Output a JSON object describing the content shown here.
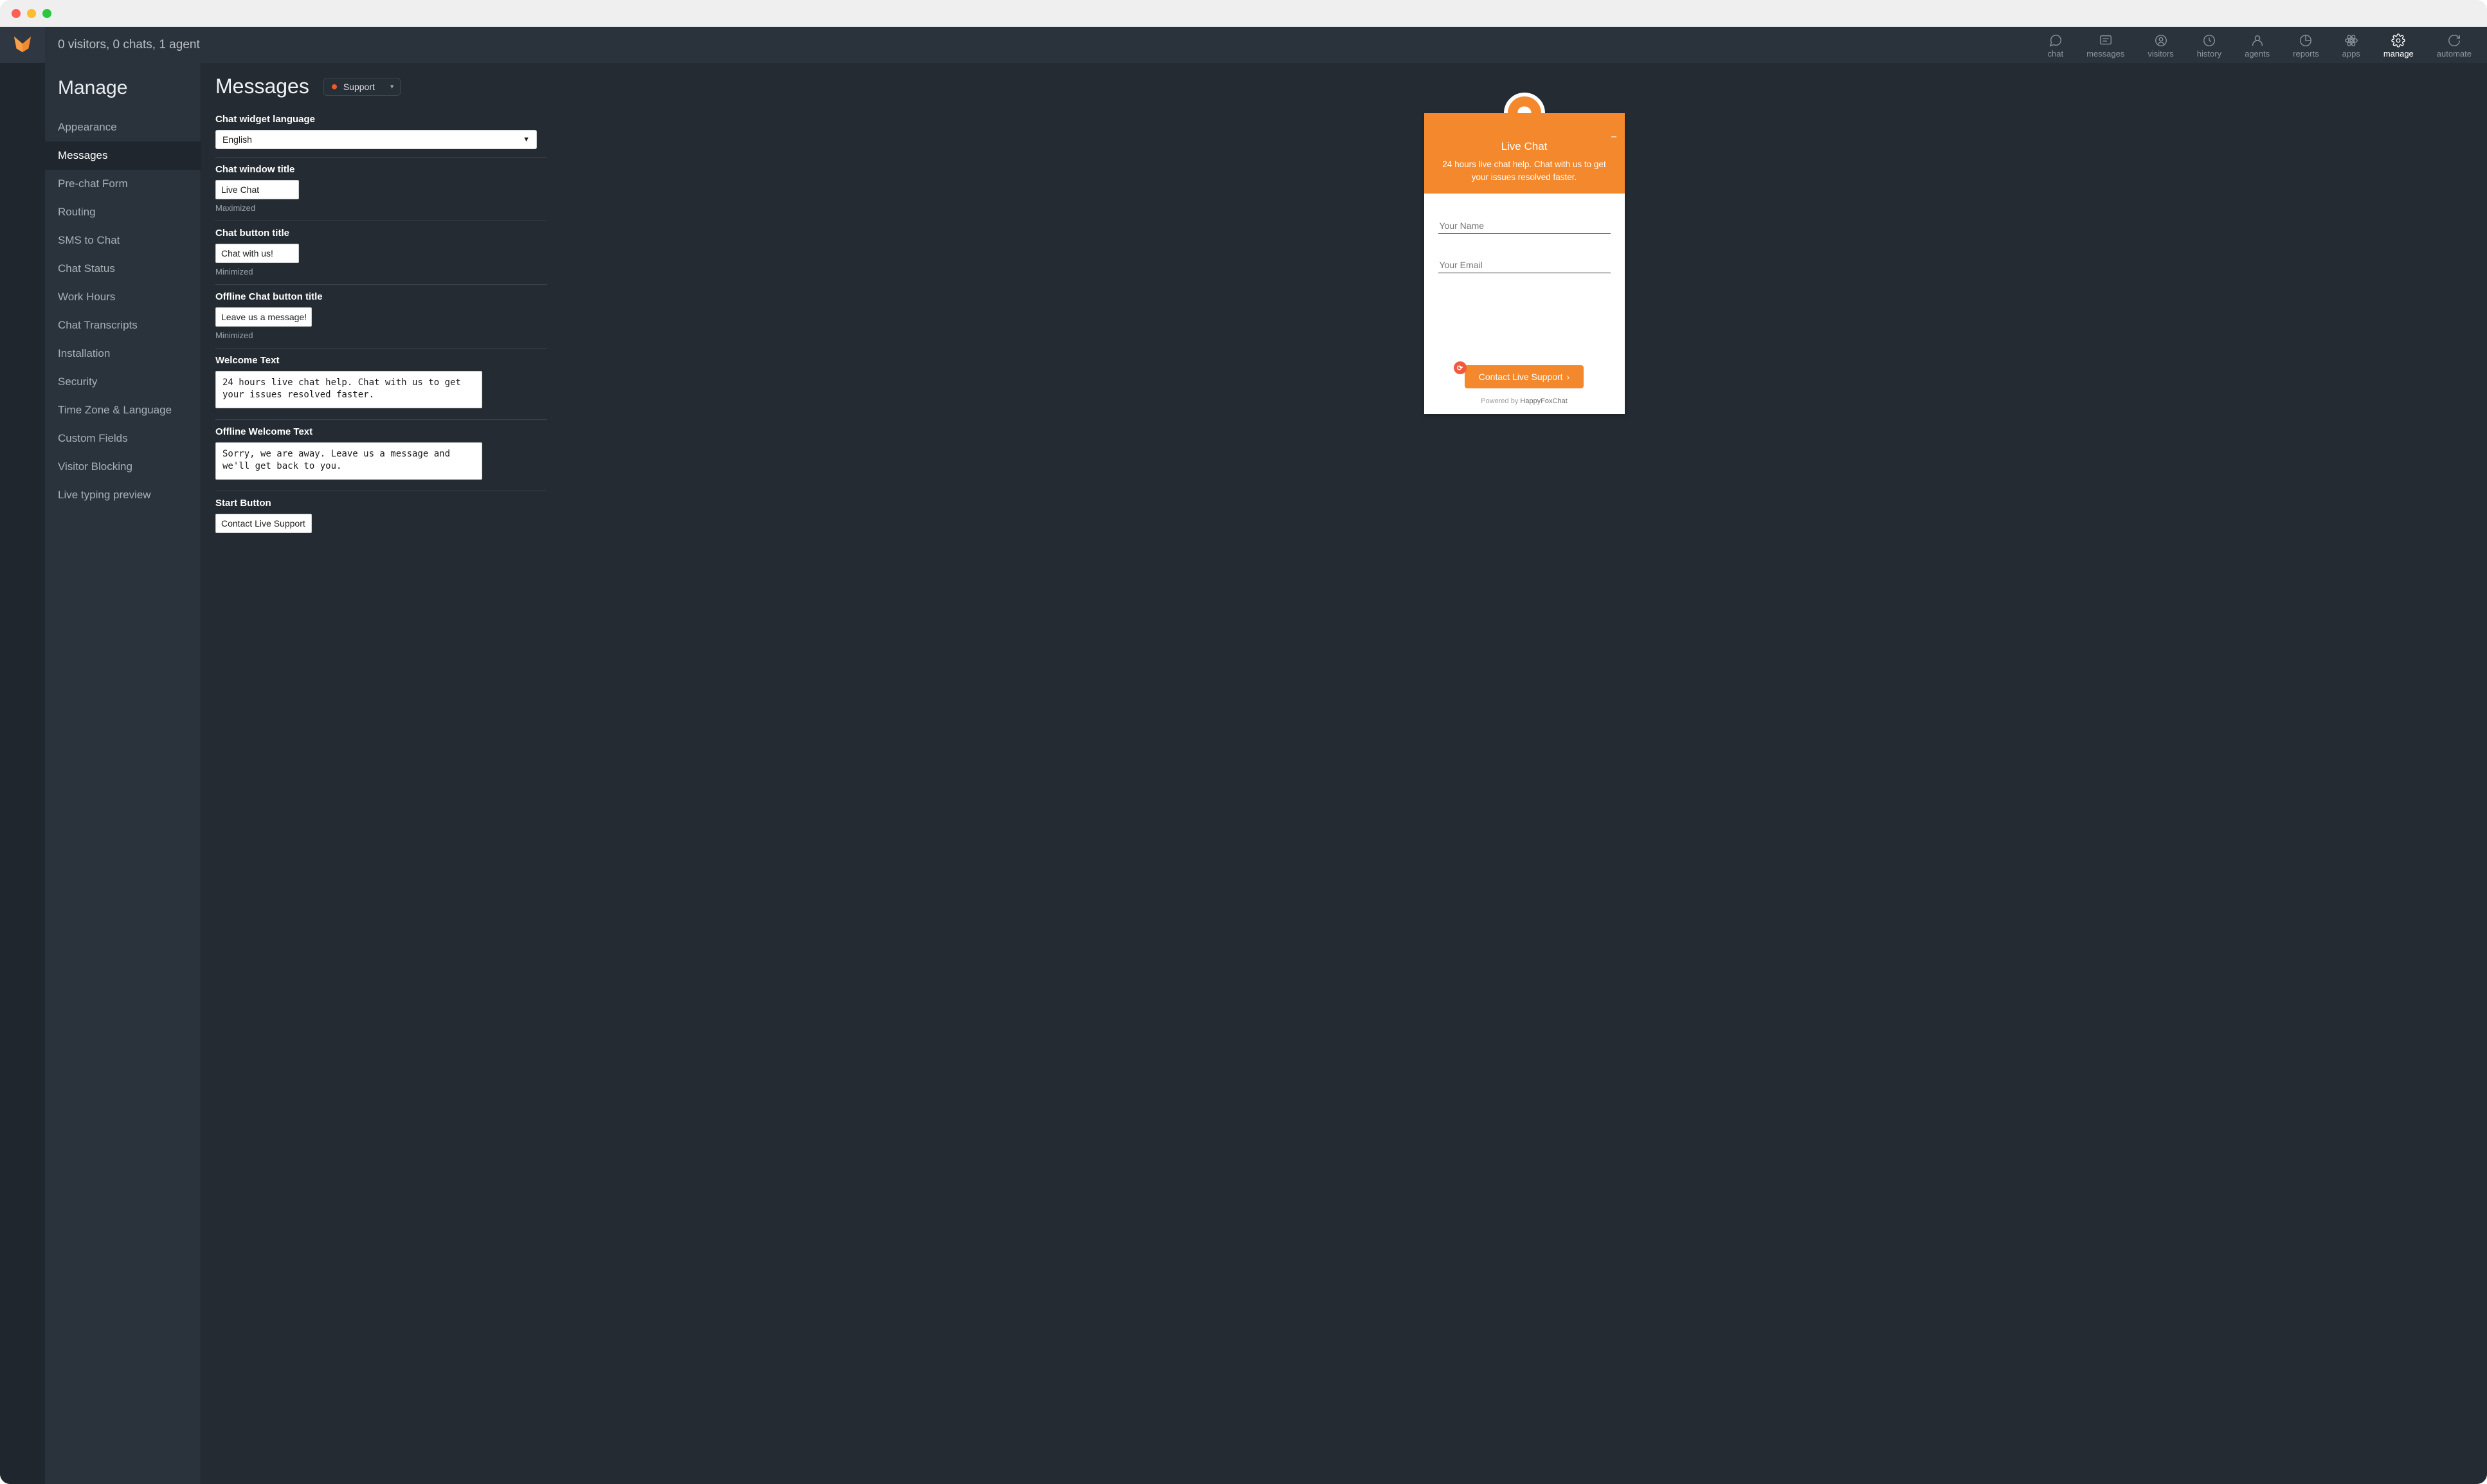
{
  "header": {
    "status": "0 visitors, 0 chats, 1 agent"
  },
  "topnav": [
    {
      "label": "chat",
      "name": "nav-chat",
      "icon": "chat-bubble-icon"
    },
    {
      "label": "messages",
      "name": "nav-messages",
      "icon": "message-square-icon"
    },
    {
      "label": "visitors",
      "name": "nav-visitors",
      "icon": "user-circle-icon"
    },
    {
      "label": "history",
      "name": "nav-history",
      "icon": "history-icon"
    },
    {
      "label": "agents",
      "name": "nav-agents",
      "icon": "agent-icon"
    },
    {
      "label": "reports",
      "name": "nav-reports",
      "icon": "pie-chart-icon"
    },
    {
      "label": "apps",
      "name": "nav-apps",
      "icon": "atom-icon"
    },
    {
      "label": "manage",
      "name": "nav-manage",
      "icon": "gear-icon",
      "active": true
    },
    {
      "label": "automate",
      "name": "nav-automate",
      "icon": "refresh-icon"
    }
  ],
  "sidebar": {
    "title": "Manage",
    "items": [
      {
        "label": "Appearance"
      },
      {
        "label": "Messages",
        "active": true
      },
      {
        "label": "Pre-chat Form"
      },
      {
        "label": "Routing"
      },
      {
        "label": "SMS to Chat"
      },
      {
        "label": "Chat Status"
      },
      {
        "label": "Work Hours"
      },
      {
        "label": "Chat Transcripts"
      },
      {
        "label": "Installation"
      },
      {
        "label": "Security"
      },
      {
        "label": "Time Zone & Language"
      },
      {
        "label": "Custom Fields"
      },
      {
        "label": "Visitor Blocking"
      },
      {
        "label": "Live typing preview"
      }
    ]
  },
  "main": {
    "title": "Messages",
    "profile": "Support",
    "groups": {
      "lang": {
        "label": "Chat widget language",
        "value": "English"
      },
      "window_title": {
        "label": "Chat window title",
        "value": "Live Chat",
        "hint": "Maximized"
      },
      "button_title": {
        "label": "Chat button title",
        "value": "Chat with us!",
        "hint": "Minimized"
      },
      "offline_button": {
        "label": "Offline Chat button title",
        "value": "Leave us a message!",
        "hint": "Minimized"
      },
      "welcome_text": {
        "label": "Welcome Text",
        "value": "24 hours live chat help. Chat with us to get your issues resolved faster."
      },
      "offline_welcome": {
        "label": "Offline Welcome Text",
        "value": "Sorry, we are away. Leave us a message and we'll get back to you."
      },
      "start_button": {
        "label": "Start Button",
        "value": "Contact Live Support"
      }
    }
  },
  "preview": {
    "title": "Live Chat",
    "welcome": "24 hours live chat help. Chat with us to get your issues resolved faster.",
    "name_placeholder": "Your Name",
    "email_placeholder": "Your Email",
    "contact_button": "Contact Live Support",
    "powered_prefix": "Powered by ",
    "powered_link": "HappyFoxChat"
  }
}
